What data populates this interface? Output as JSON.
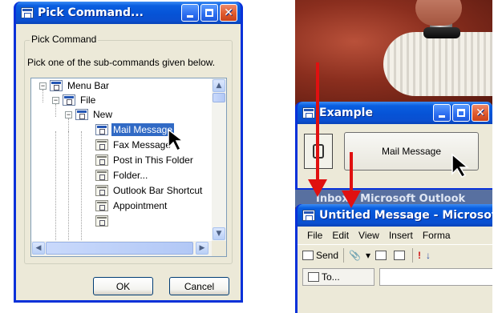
{
  "pick_dialog": {
    "title": "Pick Command...",
    "group_label": "Pick Command",
    "description": "Pick one of the sub-commands given below.",
    "tree": [
      {
        "label": "Menu Bar",
        "level": 0,
        "expander": "−",
        "selected": false
      },
      {
        "label": "File",
        "level": 1,
        "expander": "−",
        "selected": false
      },
      {
        "label": "New",
        "level": 2,
        "expander": "−",
        "selected": false
      },
      {
        "label": "Mail Message",
        "level": 3,
        "expander": "",
        "selected": true
      },
      {
        "label": "Fax Message",
        "level": 3,
        "expander": "",
        "selected": false
      },
      {
        "label": "Post in This Folder",
        "level": 3,
        "expander": "",
        "selected": false
      },
      {
        "label": "Folder...",
        "level": 3,
        "expander": "",
        "selected": false
      },
      {
        "label": "Outlook Bar Shortcut",
        "level": 3,
        "expander": "",
        "selected": false
      },
      {
        "label": "Appointment",
        "level": 3,
        "expander": "",
        "selected": false
      }
    ],
    "ok_label": "OK",
    "cancel_label": "Cancel"
  },
  "example_window": {
    "title": "Example",
    "button_label": "Mail Message"
  },
  "outlook": {
    "inbox_title": "Inbox - Microsoft Outlook"
  },
  "message_window": {
    "title": "Untitled Message - Microsoft",
    "menu": [
      "File",
      "Edit",
      "View",
      "Insert",
      "Forma"
    ],
    "send_label": "Send",
    "to_label": "To..."
  },
  "colors": {
    "xp_title_blue": "#0a5fe1",
    "selection_blue": "#316ac5",
    "arrow_red": "#e01010",
    "dialog_face": "#ece9d8"
  }
}
